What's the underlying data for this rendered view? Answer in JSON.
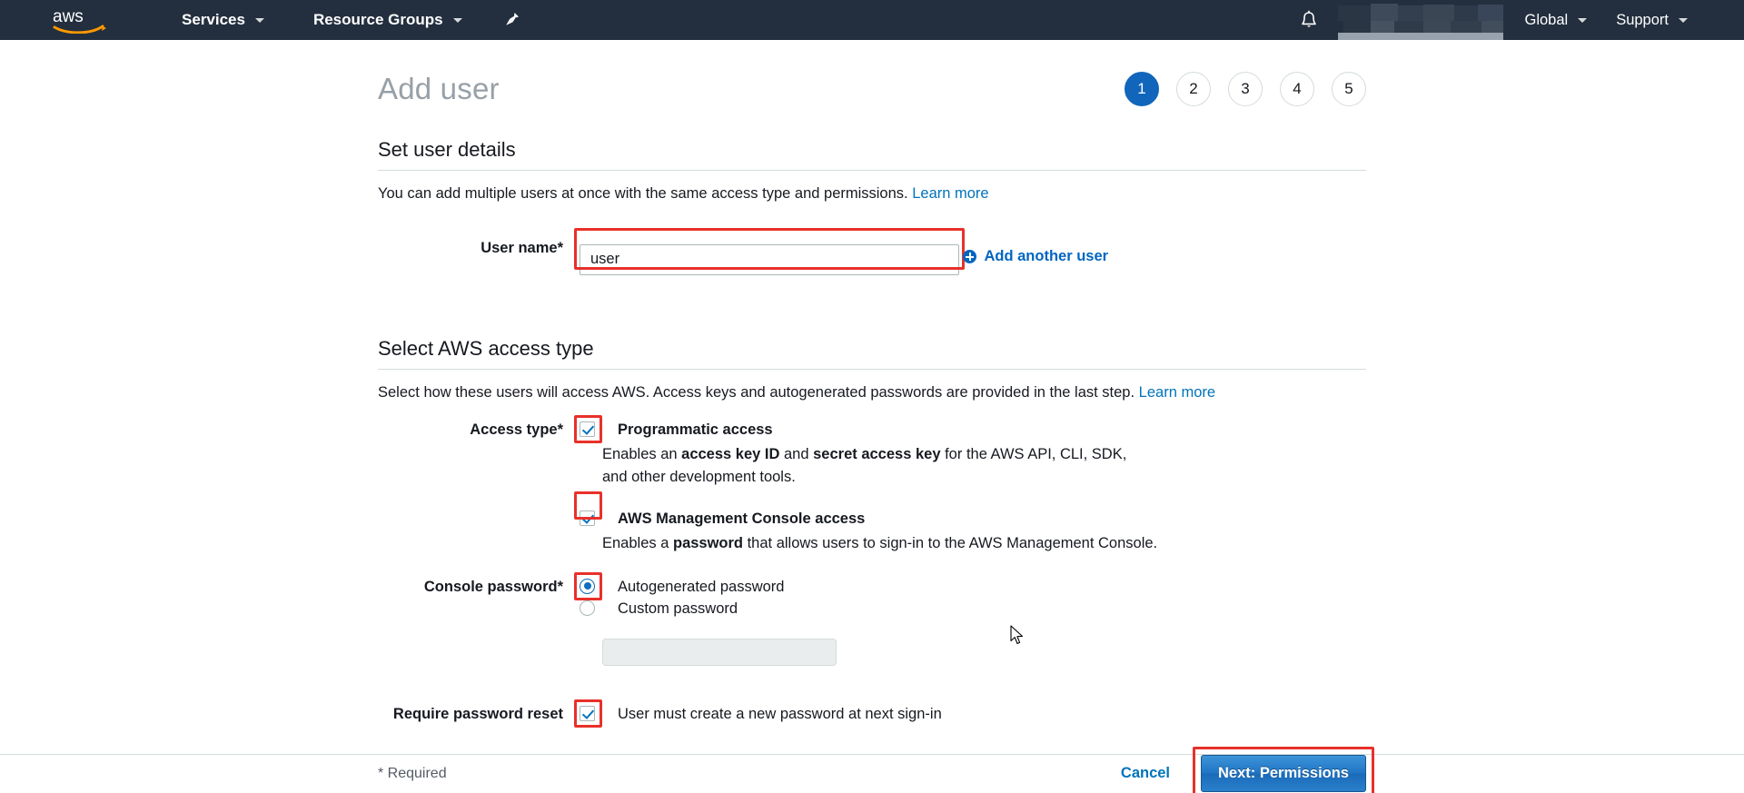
{
  "topnav": {
    "logo_icon": "aws-logo",
    "services_label": "Services",
    "resource_groups_label": "Resource Groups",
    "pin_icon": "pin-icon",
    "bell_icon": "bell-notification-icon",
    "account_label": "",
    "region_label": "Global",
    "support_label": "Support",
    "background_color": "#232f3e"
  },
  "page": {
    "title": "Add user",
    "steps": [
      {
        "number": "1",
        "active": true
      },
      {
        "number": "2",
        "active": false
      },
      {
        "number": "3",
        "active": false
      },
      {
        "number": "4",
        "active": false
      },
      {
        "number": "5",
        "active": false
      }
    ]
  },
  "user_details": {
    "heading": "Set user details",
    "description": "You can add multiple users at once with the same access type and permissions.",
    "learn_more": "Learn more",
    "user_name_label": "User name*",
    "user_name_value": "user",
    "user_name_placeholder": "",
    "add_another_label": "Add another user",
    "add_another_icon": "plus-circle-icon"
  },
  "access_type": {
    "heading": "Select AWS access type",
    "description": "Select how these users will access AWS. Access keys and autogenerated passwords are provided in the last step.",
    "learn_more": "Learn more",
    "access_type_label": "Access type*",
    "programmatic": {
      "title": "Programmatic access",
      "checked": true,
      "desc_part1": "Enables an ",
      "desc_bold1": "access key ID",
      "desc_part2": " and ",
      "desc_bold2": "secret access key",
      "desc_part3": " for the AWS API, CLI, SDK, and other development tools."
    },
    "console": {
      "title": "AWS Management Console access",
      "checked": true,
      "desc_part1": "Enables a ",
      "desc_bold1": "password",
      "desc_part2": " that allows users to sign-in to the AWS Management Console."
    },
    "console_password_label": "Console password*",
    "password_options": [
      {
        "label": "Autogenerated password",
        "selected": true
      },
      {
        "label": "Custom password",
        "selected": false
      }
    ],
    "custom_password_value": "",
    "custom_password_placeholder": "",
    "require_reset_label": "Require password reset",
    "require_reset_checked": true,
    "require_reset_text": "User must create a new password at next sign-in"
  },
  "footer": {
    "required_note": "* Required",
    "cancel_label": "Cancel",
    "next_label": "Next: Permissions"
  },
  "colors": {
    "accent_blue": "#0073bb",
    "step_active": "#1166bb",
    "annotation_red": "#e8312a",
    "nav_dark": "#232f3e"
  }
}
